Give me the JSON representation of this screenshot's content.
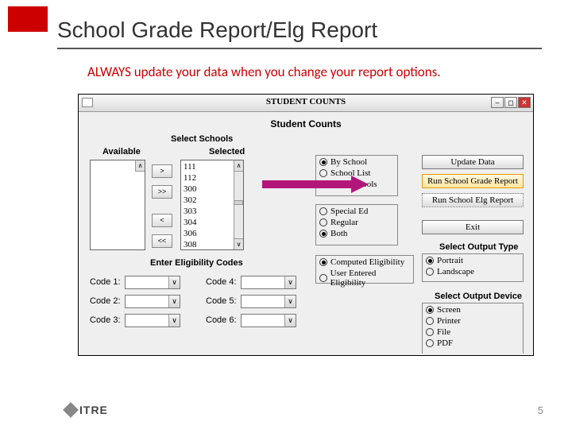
{
  "slide": {
    "title": "School Grade Report/Elg Report",
    "tip": "ALWAYS update your data when you change your report options.",
    "page_number": "5",
    "footer_logo_text": "ITRE"
  },
  "window": {
    "title": "STUDENT COUNTS",
    "subtitle": "Student Counts",
    "available_header": "Available",
    "selected_header": "Selected",
    "select_schools_label": "Select Schools",
    "move": {
      "right": ">",
      "all_right": ">>",
      "left": "<",
      "all_left": "<<"
    },
    "selected_items": [
      "111",
      "112",
      "300",
      "302",
      "303",
      "304",
      "306",
      "308"
    ],
    "by_group": {
      "options": [
        {
          "label": "By School",
          "selected": true
        },
        {
          "label": "School List",
          "selected": false
        },
        {
          "label": "ALL Schools",
          "selected": false
        }
      ]
    },
    "category_group": {
      "options": [
        {
          "label": "Special Ed",
          "selected": false
        },
        {
          "label": "Regular",
          "selected": false
        },
        {
          "label": "Both",
          "selected": true
        }
      ]
    },
    "elig_group": {
      "options": [
        {
          "label": "Computed Eligibility",
          "selected": true
        },
        {
          "label": "User Entered Eligibility",
          "selected": false
        }
      ]
    },
    "actions": {
      "update_data": "Update Data",
      "run_grade": "Run School Grade Report",
      "run_elg": "Run School Elg Report",
      "exit": "Exit"
    },
    "output_type": {
      "label": "Select Output Type",
      "options": [
        {
          "label": "Portrait",
          "selected": true
        },
        {
          "label": "Landscape",
          "selected": false
        }
      ]
    },
    "output_device": {
      "label": "Select Output Device",
      "options": [
        {
          "label": "Screen",
          "selected": true
        },
        {
          "label": "Printer",
          "selected": false
        },
        {
          "label": "File",
          "selected": false
        },
        {
          "label": "PDF",
          "selected": false
        }
      ]
    },
    "codes": {
      "section_label": "Enter Eligibility Codes",
      "c1": "Code 1:",
      "c2": "Code 2:",
      "c3": "Code 3:",
      "c4": "Code 4:",
      "c5": "Code 5:",
      "c6": "Code 6:"
    }
  }
}
